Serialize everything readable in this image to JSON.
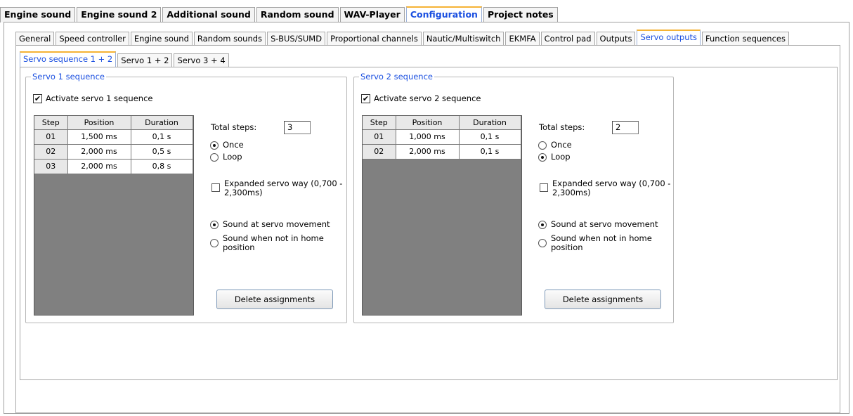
{
  "top_tabs": [
    "Engine sound",
    "Engine sound 2",
    "Additional sound",
    "Random sound",
    "WAV-Player",
    "Configuration",
    "Project notes"
  ],
  "top_active": "Configuration",
  "sub_tabs": [
    "General",
    "Speed controller",
    "Engine sound",
    "Random sounds",
    "S-BUS/SUMD",
    "Proportional channels",
    "Nautic/Multiswitch",
    "EKMFA",
    "Control pad",
    "Outputs",
    "Servo outputs",
    "Function sequences"
  ],
  "sub_active": "Servo outputs",
  "inner_tabs": [
    "Servo sequence  1 + 2",
    "Servo 1 + 2",
    "Servo 3 + 4"
  ],
  "inner_active": "Servo sequence  1 + 2",
  "accent_color": "#1a4fe0",
  "servo1": {
    "legend": "Servo 1 sequence",
    "activate_label": "Activate servo 1 sequence",
    "activate_checked": true,
    "headers": [
      "Step",
      "Position",
      "Duration"
    ],
    "rows": [
      [
        "01",
        "1,500 ms",
        "0,1 s"
      ],
      [
        "02",
        "2,000 ms",
        "0,5 s"
      ],
      [
        "03",
        "2,000 ms",
        "0,8 s"
      ]
    ],
    "total_steps_label": "Total steps:",
    "total_steps_value": "3",
    "once_label": "Once",
    "loop_label": "Loop",
    "mode": "once",
    "expanded_label": "Expanded servo way (0,700 - 2,300ms)",
    "expanded_checked": false,
    "sound_move_label": "Sound at servo movement",
    "sound_home_label": "Sound when not in home position",
    "sound_mode": "movement",
    "delete_label": "Delete assignments"
  },
  "servo2": {
    "legend": "Servo 2 sequence",
    "activate_label": "Activate servo 2 sequence",
    "activate_checked": true,
    "headers": [
      "Step",
      "Position",
      "Duration"
    ],
    "rows": [
      [
        "01",
        "1,000 ms",
        "0,1 s"
      ],
      [
        "02",
        "2,000 ms",
        "0,1 s"
      ]
    ],
    "total_steps_label": "Total steps:",
    "total_steps_value": "2",
    "once_label": "Once",
    "loop_label": "Loop",
    "mode": "loop",
    "expanded_label": "Expanded servo way (0,700 - 2,300ms)",
    "expanded_checked": false,
    "sound_move_label": "Sound at servo movement",
    "sound_home_label": "Sound when not in home position",
    "sound_mode": "movement",
    "delete_label": "Delete assignments"
  }
}
